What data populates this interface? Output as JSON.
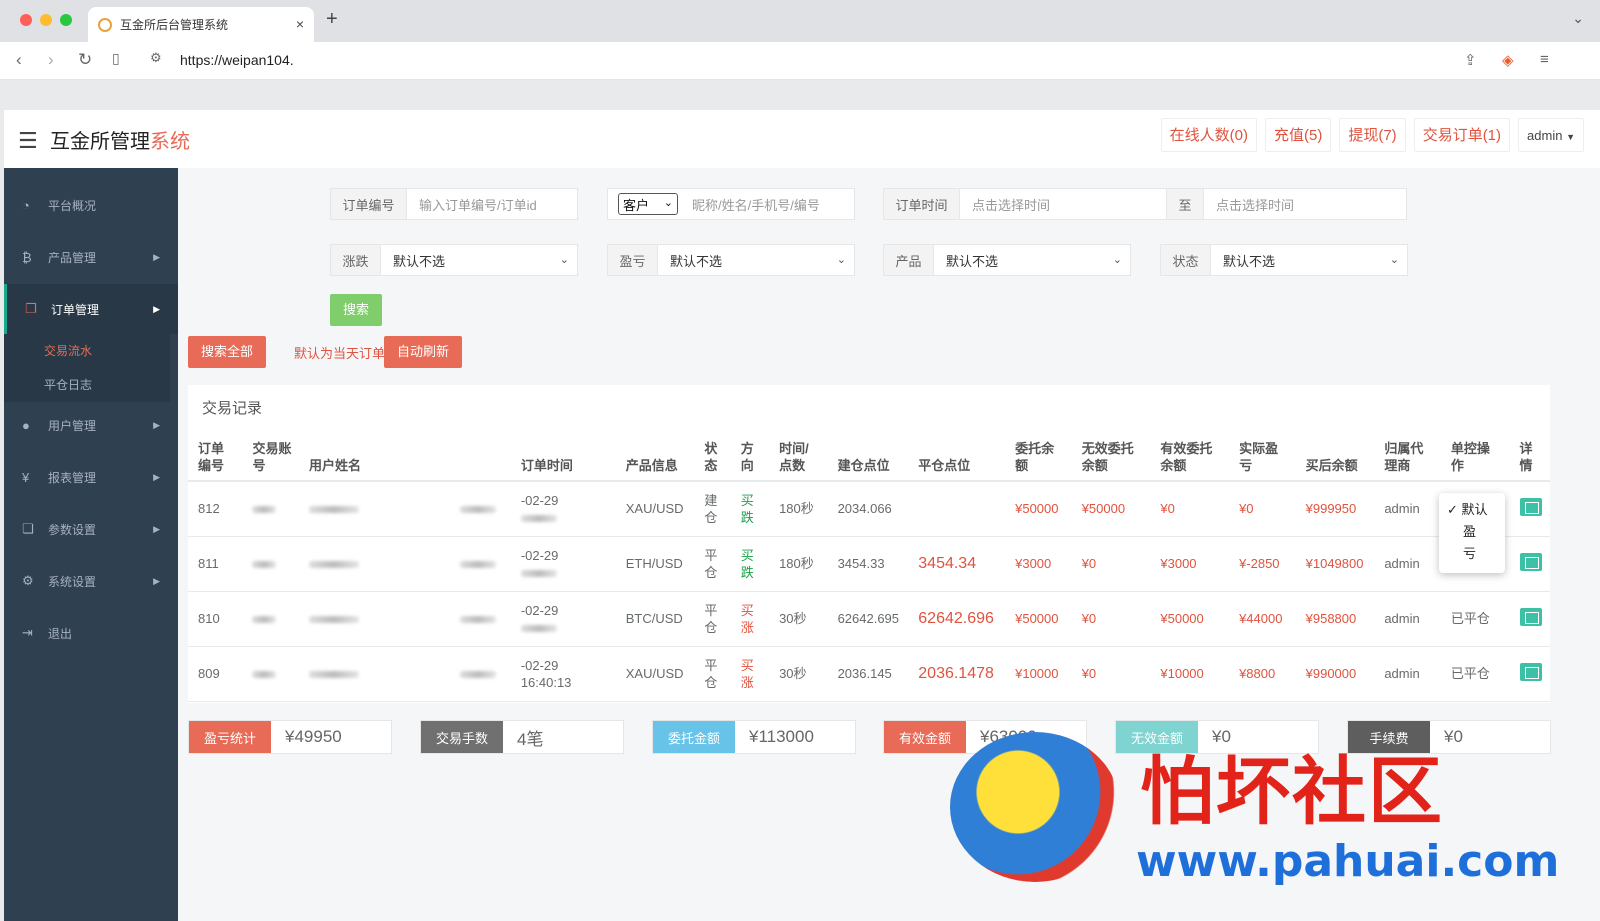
{
  "browser": {
    "tab_title": "互金所后台管理系统",
    "tab_close": "×",
    "new_tab": "+",
    "url": "https://weipan104."
  },
  "app": {
    "brand_main": "互金所管理",
    "brand_accent": "系统",
    "topnav": [
      "在线人数(0)",
      "充值(5)",
      "提现(7)",
      "交易订单(1)"
    ],
    "user": "admin"
  },
  "sidebar": {
    "items": [
      {
        "label": "平台概况",
        "icon": "dashboard-icon"
      },
      {
        "label": "产品管理",
        "icon": "bitcoin-icon"
      },
      {
        "label": "订单管理",
        "icon": "copy-icon"
      },
      {
        "label": "用户管理",
        "icon": "user-icon"
      },
      {
        "label": "报表管理",
        "icon": "yen-icon"
      },
      {
        "label": "参数设置",
        "icon": "file-icon"
      },
      {
        "label": "系统设置",
        "icon": "gears-icon"
      },
      {
        "label": "退出",
        "icon": "signout-icon"
      }
    ],
    "subitems": [
      "交易流水",
      "平仓日志"
    ]
  },
  "filters": {
    "order_no_label": "订单编号",
    "order_no_placeholder": "输入订单编号/订单id",
    "client_select": "客户",
    "client_placeholder": "昵称/姓名/手机号/编号",
    "time_label": "订单时间",
    "time_from_placeholder": "点击选择时间",
    "time_to_label": "至",
    "time_to_placeholder": "点击选择时间",
    "rise_label": "涨跌",
    "profit_label": "盈亏",
    "product_label": "产品",
    "status_label": "状态",
    "default_option": "默认不选",
    "search_btn": "搜索",
    "search_all_btn": "搜索全部",
    "default_hint": "默认为当天订单",
    "auto_refresh_btn": "自动刷新"
  },
  "records": {
    "title": "交易记录",
    "headers": [
      "订单\n编号",
      "交易账\n号",
      "用户姓名",
      "",
      "订单时间",
      "产品信息",
      "状\n态",
      "方\n向",
      "时间/\n点数",
      "建仓点位",
      "平仓点位",
      "委托余\n额",
      "无效委托\n余额",
      "有效委托\n余额",
      "实际盈\n亏",
      "买后余额",
      "归属代\n理商",
      "单控操\n作",
      "详\n情"
    ],
    "rows": [
      {
        "id": "812",
        "time1": "-02-29",
        "time2": "",
        "product": "XAU/USD",
        "status": "建\n仓",
        "dir": "买\n跌",
        "dir_color": "up",
        "dur": "180秒",
        "open": "2034.066",
        "close": "",
        "entrust": "¥50000",
        "invalid": "¥50000",
        "valid": "¥0",
        "profit": "¥0",
        "after": "¥999950",
        "agent": "admin",
        "ctrl": ""
      },
      {
        "id": "811",
        "time1": "-02-29",
        "time2": "",
        "product": "ETH/USD",
        "status": "平\n仓",
        "dir": "买\n跌",
        "dir_color": "up",
        "dur": "180秒",
        "open": "3454.33",
        "close": "3454.34",
        "entrust": "¥3000",
        "invalid": "¥0",
        "valid": "¥3000",
        "profit": "¥-2850",
        "after": "¥1049800",
        "agent": "admin",
        "ctrl": ""
      },
      {
        "id": "810",
        "time1": "-02-29",
        "time2": "",
        "product": "BTC/USD",
        "status": "平\n仓",
        "dir": "买\n涨",
        "dir_color": "dn",
        "dur": "30秒",
        "open": "62642.695",
        "close": "62642.696",
        "entrust": "¥50000",
        "invalid": "¥0",
        "valid": "¥50000",
        "profit": "¥44000",
        "after": "¥958800",
        "agent": "admin",
        "ctrl": "已平仓"
      },
      {
        "id": "809",
        "time1": "-02-29",
        "time2": "16:40:13",
        "product": "XAU/USD",
        "status": "平\n仓",
        "dir": "买\n涨",
        "dir_color": "dn",
        "dur": "30秒",
        "open": "2036.145",
        "close": "2036.1478",
        "entrust": "¥10000",
        "invalid": "¥0",
        "valid": "¥10000",
        "profit": "¥8800",
        "after": "¥990000",
        "agent": "admin",
        "ctrl": "已平仓"
      }
    ],
    "popup_options": [
      "✓ 默认",
      "盈",
      "亏"
    ]
  },
  "stats": [
    {
      "label": "盈亏统计",
      "value": "¥49950",
      "color": "#e86b57"
    },
    {
      "label": "交易手数",
      "value": "4笔",
      "color": "#707070"
    },
    {
      "label": "委托金额",
      "value": "¥113000",
      "color": "#67c3e8"
    },
    {
      "label": "有效金额",
      "value": "¥63000",
      "color": "#e86b57"
    },
    {
      "label": "无效金额",
      "value": "¥0",
      "color": "#7fd3d0"
    },
    {
      "label": "手续费",
      "value": "¥0",
      "color": "#5e5e5e"
    }
  ],
  "watermark": {
    "zh": "怕坏社区",
    "en": "www.pahuai.com"
  }
}
